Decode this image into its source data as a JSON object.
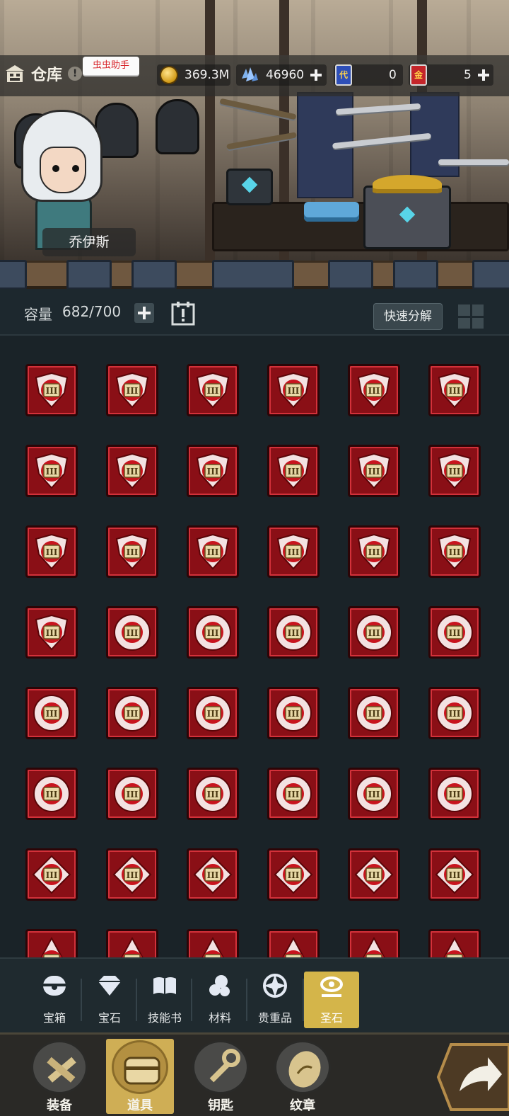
{
  "header": {
    "title": "仓库",
    "help_symbol": "!",
    "helper_tag": "虫虫助手",
    "hero_name": "乔伊斯"
  },
  "resources": {
    "gold": "369.3M",
    "crystals": "46960",
    "blue_ticket_glyph": "代",
    "blue_ticket_count": "0",
    "red_ticket_glyph": "金",
    "red_ticket_count": "5"
  },
  "capacity": {
    "label": "容量",
    "value": "682/700",
    "quick_decompose": "快速分解"
  },
  "items": {
    "tier": "III",
    "rows": [
      [
        "shield",
        "shield",
        "shield",
        "shield",
        "shield",
        "shield"
      ],
      [
        "shield",
        "shield",
        "shield",
        "shield",
        "shield",
        "shield"
      ],
      [
        "shield",
        "shield",
        "shield",
        "shield",
        "shield",
        "shield"
      ],
      [
        "shield",
        "round",
        "round",
        "round",
        "round",
        "round"
      ],
      [
        "round",
        "round",
        "round",
        "round",
        "round",
        "round"
      ],
      [
        "round",
        "round",
        "round",
        "round",
        "round",
        "round"
      ],
      [
        "diamond",
        "diamond",
        "diamond",
        "diamond",
        "diamond",
        "diamond"
      ],
      [
        "triangle",
        "triangle",
        "triangle",
        "triangle",
        "triangle",
        "triangle"
      ]
    ],
    "color": "#c8141e"
  },
  "categories": [
    {
      "label": "宝箱",
      "icon": "chest-icon",
      "active": false
    },
    {
      "label": "宝石",
      "icon": "gem-icon",
      "active": false
    },
    {
      "label": "技能书",
      "icon": "book-icon",
      "active": false
    },
    {
      "label": "材料",
      "icon": "material-icon",
      "active": false
    },
    {
      "label": "贵重品",
      "icon": "valuable-icon",
      "active": false
    },
    {
      "label": "圣石",
      "icon": "holy-stone-icon",
      "active": true
    }
  ],
  "bottom_nav": [
    {
      "label": "装备",
      "icon": "equipment-icon",
      "active": false
    },
    {
      "label": "道具",
      "icon": "items-icon",
      "active": true
    },
    {
      "label": "钥匙",
      "icon": "key-icon",
      "active": false
    },
    {
      "label": "纹章",
      "icon": "emblem-icon",
      "active": false
    }
  ],
  "colors": {
    "accent_gold": "#d4b54a",
    "slot_red": "#8a0f16",
    "panel_dark": "#1a2328"
  }
}
